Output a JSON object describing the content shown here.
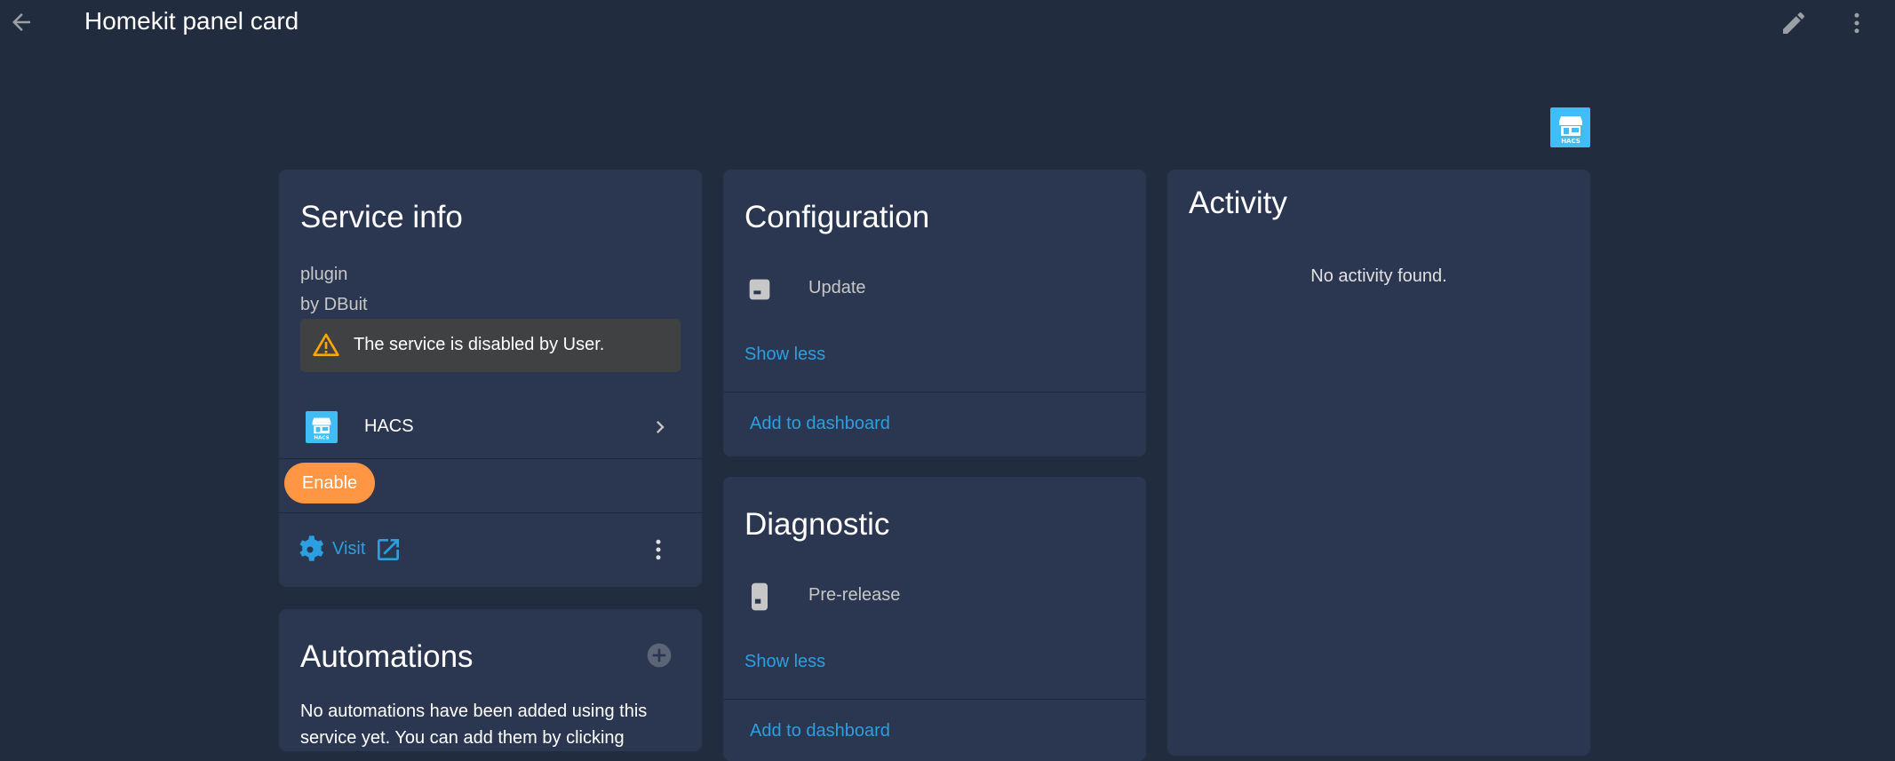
{
  "header": {
    "title": "Homekit panel card",
    "back_icon": "arrow-left-icon",
    "edit_icon": "pencil-icon",
    "menu_icon": "dots-vertical-icon"
  },
  "brand": {
    "logo_icon": "hacs-icon",
    "logo_label": "HACS"
  },
  "service_info": {
    "title": "Service info",
    "type": "plugin",
    "author": "by DBuit",
    "warning": "The service is disabled by User.",
    "device": {
      "name": "HACS",
      "logo_label": "HACS",
      "icon": "hacs-icon"
    },
    "enable_label": "Enable",
    "visit_label": "Visit",
    "visit_icon": "cog-icon",
    "external_icon": "open-in-new-icon"
  },
  "automations": {
    "title": "Automations",
    "add_icon": "plus-circle-icon",
    "empty_text": "No automations have been added using this service yet. You can add them by clicking"
  },
  "configuration": {
    "title": "Configuration",
    "entity_label": "Update",
    "entity_icon": "package-icon",
    "show_less_label": "Show less",
    "add_to_dashboard_label": "Add to dashboard"
  },
  "diagnostic": {
    "title": "Diagnostic",
    "entity_label": "Pre-release",
    "entity_icon": "remote-icon",
    "show_less_label": "Show less",
    "add_to_dashboard_label": "Add to dashboard"
  },
  "activity": {
    "title": "Activity",
    "empty_text": "No activity found."
  },
  "colors": {
    "background": "#222c3f",
    "card": "#2b3750",
    "accent": "#2c9fe0",
    "enable_button": "#ff9643",
    "warning": "#ffa600",
    "hacs_blue": "#41bdf5"
  }
}
